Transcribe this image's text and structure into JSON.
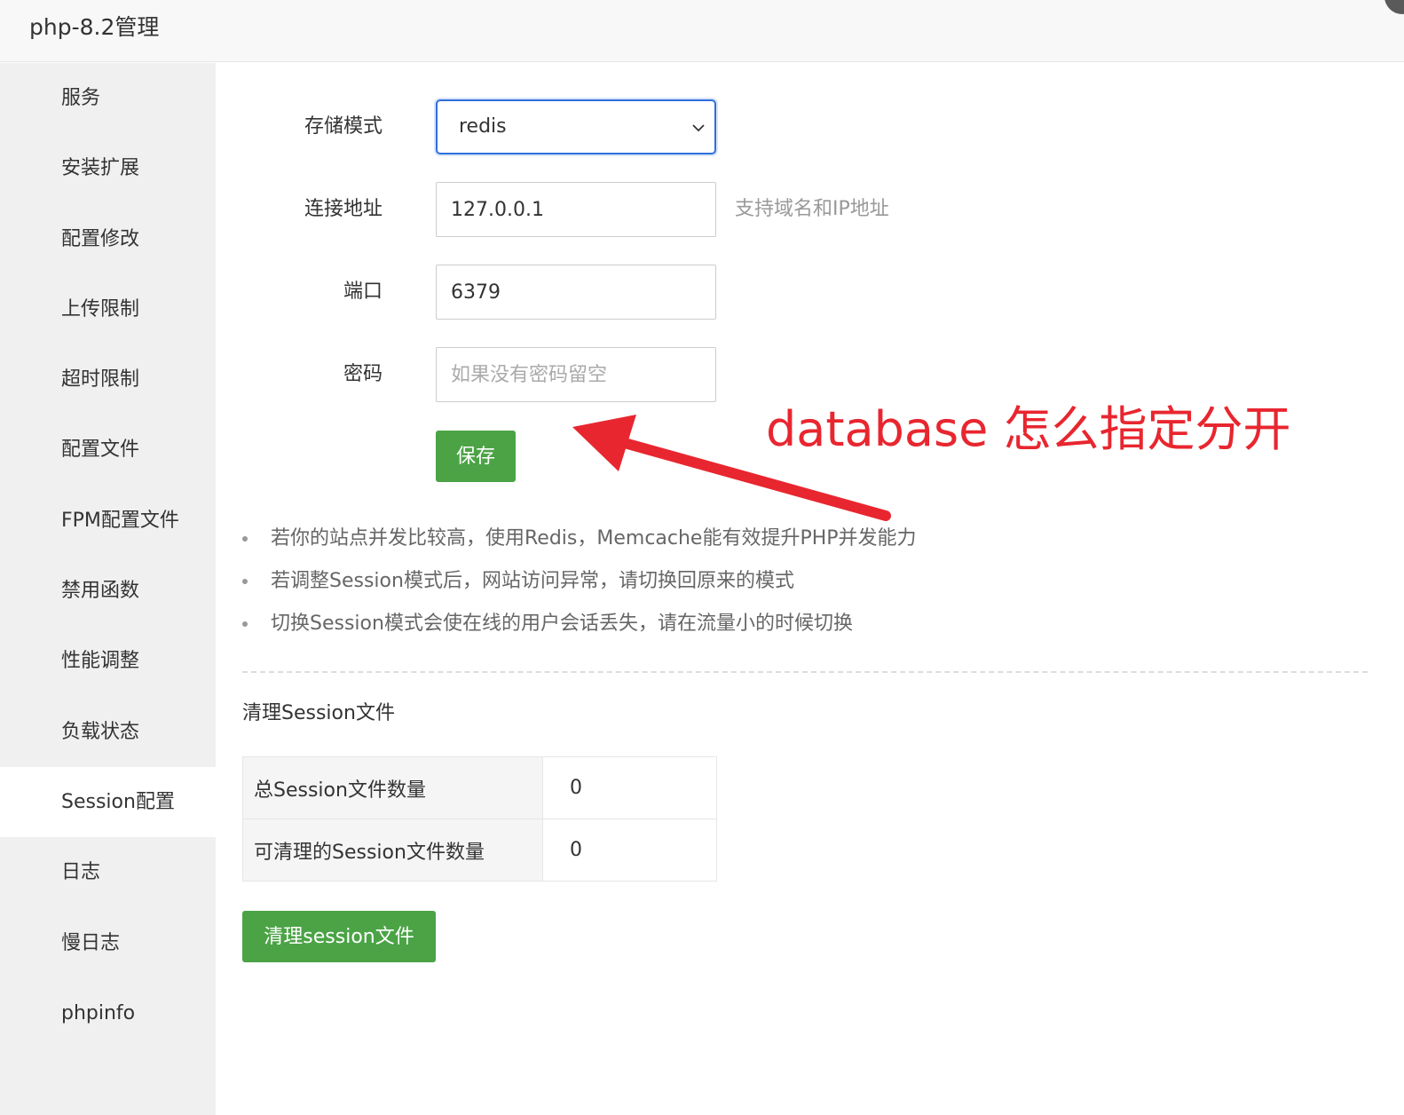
{
  "window": {
    "title": "php-8.2管理",
    "close_glyph": "✕"
  },
  "sidebar": {
    "items": [
      {
        "label": "服务"
      },
      {
        "label": "安装扩展"
      },
      {
        "label": "配置修改"
      },
      {
        "label": "上传限制"
      },
      {
        "label": "超时限制"
      },
      {
        "label": "配置文件"
      },
      {
        "label": "FPM配置文件"
      },
      {
        "label": "禁用函数"
      },
      {
        "label": "性能调整"
      },
      {
        "label": "负载状态"
      },
      {
        "label": "Session配置",
        "active": true
      },
      {
        "label": "日志"
      },
      {
        "label": "慢日志"
      },
      {
        "label": "phpinfo"
      }
    ]
  },
  "form": {
    "storage_mode": {
      "label": "存储模式",
      "value": "redis"
    },
    "address": {
      "label": "连接地址",
      "value": "127.0.0.1",
      "hint": "支持域名和IP地址"
    },
    "port": {
      "label": "端口",
      "value": "6379"
    },
    "password": {
      "label": "密码",
      "placeholder": "如果没有密码留空",
      "value": ""
    },
    "save_label": "保存"
  },
  "annotation": {
    "text": "database 怎么指定分开",
    "color": "#e8262f"
  },
  "tips": [
    "若你的站点并发比较高，使用Redis，Memcache能有效提升PHP并发能力",
    "若调整Session模式后，网站访问异常，请切换回原来的模式",
    "切换Session模式会使在线的用户会话丢失，请在流量小的时候切换"
  ],
  "session_clean": {
    "title": "清理Session文件",
    "rows": [
      {
        "label": "总Session文件数量",
        "value": "0"
      },
      {
        "label": "可清理的Session文件数量",
        "value": "0"
      }
    ],
    "button_label": "清理session文件"
  },
  "colors": {
    "primary_button": "#4ba346",
    "focus_border": "#2f6fdb",
    "sidebar_bg": "#f0f0f0"
  }
}
